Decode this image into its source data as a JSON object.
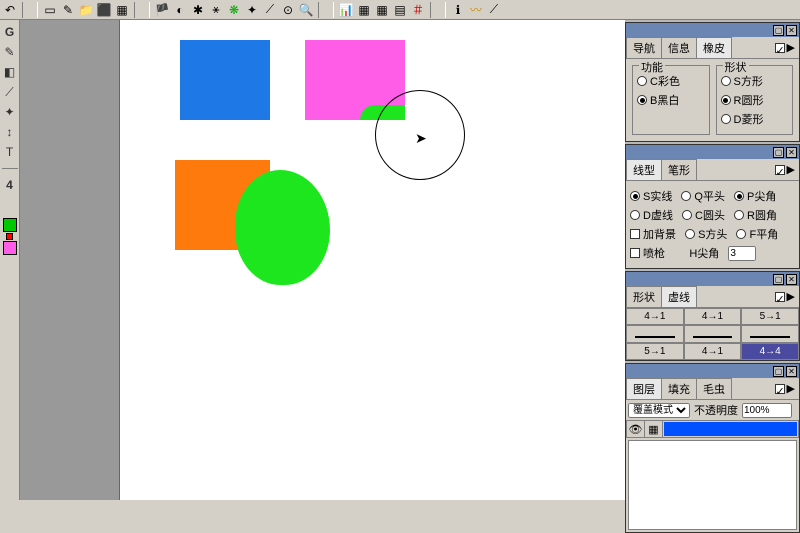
{
  "toolbar": {
    "icons": [
      "↶",
      "▭",
      "✎",
      "📁",
      "⬛",
      "▦",
      "🏴",
      "◐",
      "✱",
      "⚹",
      "❋",
      "✦",
      "⟋",
      "⊙",
      "🔍",
      "📊",
      "▦",
      "▦",
      "▤",
      "＃",
      "ℹ",
      "〰",
      "⟋"
    ]
  },
  "left_tools": {
    "icons": [
      "G",
      "✎",
      "◧",
      "⟋",
      "✦",
      "↕",
      "T"
    ],
    "label_4": "4",
    "swatches": [
      "#00c800",
      "#ff0000",
      "#ff5ce8"
    ]
  },
  "panel1": {
    "tabs": [
      "导航",
      "信息",
      "橡皮"
    ],
    "group1_title": "功能",
    "radio_color": "C彩色",
    "radio_bw": "B黑白",
    "group2_title": "形状",
    "radio_sq": "S方形",
    "radio_round": "R圆形",
    "radio_diam": "D菱形"
  },
  "panel2": {
    "tabs": [
      "线型",
      "笔形"
    ],
    "r1": "S实线",
    "r2": "Q平头",
    "r3": "P尖角",
    "r4": "D虚线",
    "r5": "C圆头",
    "r6": "R圆角",
    "chk_bg": "加背景",
    "r7": "S方头",
    "r8": "F平角",
    "chk_spray": "喷枪",
    "r9": "H尖角",
    "num": "3"
  },
  "panel3": {
    "tabs": [
      "形状",
      "虚线"
    ],
    "cells": [
      "4→1",
      "4→1",
      "5→1",
      "",
      "",
      "",
      "5→1",
      "4→1",
      "4→4"
    ]
  },
  "panel4": {
    "tabs": [
      "图层",
      "填充",
      "毛虫"
    ],
    "mode_label": "覆盖模式",
    "opacity_label": "不透明度",
    "opacity_val": "100%"
  }
}
